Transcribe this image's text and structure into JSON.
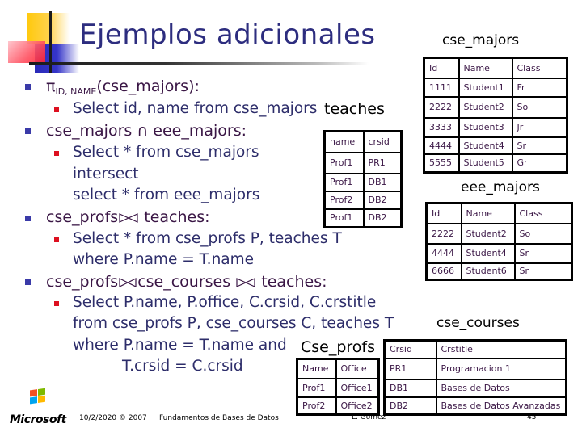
{
  "slide": {
    "title": "Ejemplos adicionales"
  },
  "bullets": {
    "b1": {
      "pi": "π",
      "sub": "ID, NAME",
      "rest": "(cse_majors):",
      "sub1": "Select id, name from cse_majors"
    },
    "b2": {
      "text": "cse_majors ∩ eee_majors:",
      "sub1": "Select * from cse_majors",
      "sub2": "intersect",
      "sub3": "select * from eee_majors"
    },
    "b3": {
      "left": "cse_profs",
      "right": "teaches:",
      "sub1": "Select * from cse_profs P, teaches T",
      "sub2": "where P.name = T.name"
    },
    "b4": {
      "left": "cse_profs",
      "mid": "cse_courses",
      "right": "teaches:",
      "sub1": "Select P.name, P.office, C.crsid, C.crstitle",
      "sub2": "from cse_profs P, cse_courses C, teaches T",
      "sub3": "where P.name = T.name and",
      "sub4": "T.crsid = C.crsid"
    }
  },
  "tables": {
    "cse_majors": {
      "caption": "cse_majors",
      "headers": [
        "Id",
        "Name",
        "Class"
      ],
      "rows": [
        [
          "1111",
          "Student1",
          "Fr"
        ],
        [
          "2222",
          "Student2",
          "So"
        ],
        [
          "3333",
          "Student3",
          "Jr"
        ],
        [
          "4444",
          "Student4",
          "Sr"
        ],
        [
          "5555",
          "Student5",
          "Gr"
        ]
      ]
    },
    "eee_majors": {
      "caption": "eee_majors",
      "headers": [
        "Id",
        "Name",
        "Class"
      ],
      "rows": [
        [
          "2222",
          "Student2",
          "So"
        ],
        [
          "4444",
          "Student4",
          "Sr"
        ],
        [
          "6666",
          "Student6",
          "Sr"
        ]
      ]
    },
    "teaches": {
      "caption": "teaches",
      "headers": [
        "name",
        "crsid"
      ],
      "rows": [
        [
          "Prof1",
          "PR1"
        ],
        [
          "Prof1",
          "DB1"
        ],
        [
          "Prof2",
          "DB2"
        ],
        [
          "Prof1",
          "DB2"
        ]
      ]
    },
    "cse_profs": {
      "caption": "Cse_profs",
      "headers": [
        "Name",
        "Office"
      ],
      "rows": [
        [
          "Prof1",
          "Office1"
        ],
        [
          "Prof2",
          "Office2"
        ]
      ]
    },
    "cse_courses": {
      "caption": "cse_courses",
      "headers": [
        "Crsid",
        "Crstitle"
      ],
      "rows": [
        [
          "PR1",
          "Programacion 1"
        ],
        [
          "DB1",
          "Bases de Datos"
        ],
        [
          "DB2",
          "Bases de Datos Avanzadas"
        ]
      ]
    }
  },
  "footer": {
    "logo": "Microsoft",
    "date": "10/2/2020 © 2007",
    "course": "Fundamentos de Bases de Datos",
    "author": "L. Gomez",
    "page": "45"
  },
  "colors": {
    "title": "#2d2d7f",
    "bullet_l1": "#3a3aa8",
    "bullet_l2": "#dd1020",
    "text_l1": "#3a1645",
    "text_l2": "#2d2d6a"
  }
}
